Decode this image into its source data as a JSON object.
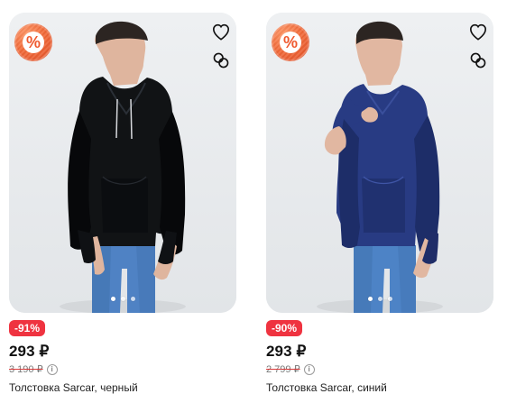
{
  "products": [
    {
      "discount": "-91%",
      "price": "293 ₽",
      "old_price": "3 190 ₽",
      "title": "Толстовка Sarcar, черный",
      "promo_icon": "percent-badge-icon",
      "favorite_icon": "heart-icon",
      "compare_icon": "compare-icon",
      "image_dots": 3,
      "image_active_dot": 1,
      "colors": {
        "hoodie": "#111315",
        "hoodie_shadow": "#07080a",
        "jeans": "#4f82c4",
        "jeans_shadow": "#3c6ea9",
        "skin": "#dfb59e",
        "hair": "#2c2522"
      }
    },
    {
      "discount": "-90%",
      "price": "293 ₽",
      "old_price": "2 799 ₽",
      "title": "Толстовка Sarcar, синий",
      "promo_icon": "percent-badge-icon",
      "favorite_icon": "heart-icon",
      "compare_icon": "compare-icon",
      "image_dots": 3,
      "image_active_dot": 1,
      "colors": {
        "hoodie": "#283b83",
        "hoodie_shadow": "#1d2d68",
        "jeans": "#4d83c6",
        "jeans_shadow": "#3d6ea8",
        "skin": "#e1b7a1",
        "hair": "#2c2522"
      }
    }
  ],
  "theme": {
    "discount_bg": "#ef3340",
    "card_bg": "#e8eaec",
    "promo_badge": "#ef5a30",
    "icon_color": "#111111"
  }
}
